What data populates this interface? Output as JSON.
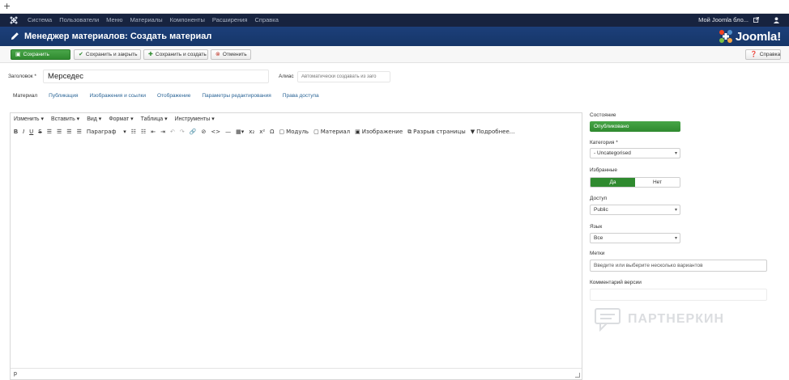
{
  "browser": {
    "new_tab_icon": "plus-icon",
    "new_tab_label": "+"
  },
  "navbar": {
    "logo_icon": "joomla-icon",
    "items": [
      "Система",
      "Пользователи",
      "Меню",
      "Материалы",
      "Компоненты",
      "Расширения",
      "Справка"
    ],
    "site_link": "Мой Joomla бло...",
    "site_link_icon": "external-link-icon",
    "user_icon": "user-icon"
  },
  "header": {
    "icon": "pencil-icon",
    "title": "Менеджер материалов: Создать материал",
    "brand": "Joomla!",
    "brand_color": "#1c3f7a"
  },
  "toolbar": {
    "save": "Сохранить",
    "save_close": "Сохранить и закрыть",
    "save_new": "Сохранить и создать",
    "cancel": "Отменить",
    "help": "Справка",
    "accent_green": "#2f8a2f"
  },
  "form": {
    "title_label": "Заголовок *",
    "title_value": "Мерседес",
    "alias_label": "Алиас",
    "alias_placeholder": "Автоматически создавать из заго"
  },
  "tabs": [
    "Материал",
    "Публикация",
    "Изображения и ссылки",
    "Отображение",
    "Параметры редактирования",
    "Права доступа"
  ],
  "editor": {
    "menus": [
      "Изменить",
      "Вставить",
      "Вид",
      "Формат",
      "Таблица",
      "Инструменты"
    ],
    "paragraph": "Параграф",
    "module_btn": "Модуль",
    "article_btn": "Материал",
    "image_btn": "Изображение",
    "pagebreak_btn": "Разрыв страницы",
    "readmore_btn": "Подробнее...",
    "status_path": "p"
  },
  "sidebar": {
    "state_label": "Состояние",
    "state_value": "Опубликовано",
    "category_label": "Категория *",
    "category_value": "- Uncategorised",
    "featured_label": "Избранные",
    "featured_yes": "Да",
    "featured_no": "Нет",
    "access_label": "Доступ",
    "access_value": "Public",
    "language_label": "Язык",
    "language_value": "Все",
    "tags_label": "Метки",
    "tags_placeholder": "Введите или выберите несколько вариантов",
    "version_label": "Комментарий версии"
  },
  "watermark": {
    "text": "ПАРТНЕРКИН",
    "icon": "chat-bubble-icon"
  }
}
